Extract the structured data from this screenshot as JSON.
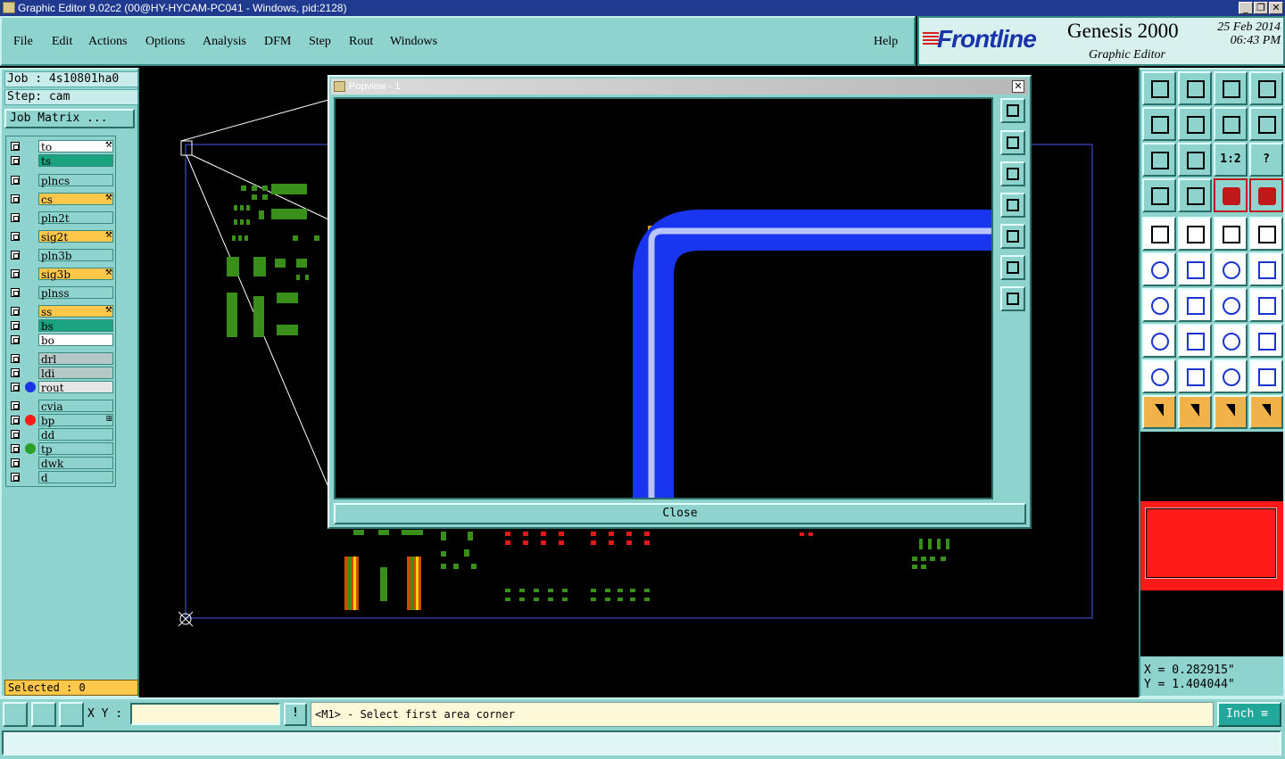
{
  "window": {
    "title": "Graphic Editor 9.02c2 (00@HY-HYCAM-PC041 - Windows, pid:2128)",
    "min": "_",
    "max": "❐",
    "close": "✕"
  },
  "menu": {
    "items": [
      "File",
      "Edit",
      "Actions",
      "Options",
      "Analysis",
      "DFM",
      "Step",
      "Rout",
      "Windows"
    ],
    "help": "Help"
  },
  "brand": {
    "logo": "Frontline",
    "product": "Genesis 2000",
    "subtitle": "Graphic Editor",
    "date": "25 Feb 2014",
    "time": "06:43 PM"
  },
  "job": {
    "job_label": "Job : 4s10801ha0",
    "step_label": "Step: cam",
    "matrix_button": "Job Matrix ..."
  },
  "layers": [
    {
      "name": "to",
      "bg": "#ffffff",
      "mark": "⚒"
    },
    {
      "name": "ts",
      "bg": "#1aa37e",
      "mark": ""
    },
    {
      "name": "plncs",
      "bg": "#8fd3cf",
      "mark": ""
    },
    {
      "name": "cs",
      "bg": "#ffc84a",
      "mark": "⚒"
    },
    {
      "name": "pln2t",
      "bg": "#8fd3cf",
      "mark": ""
    },
    {
      "name": "sig2t",
      "bg": "#ffc84a",
      "mark": "⚒"
    },
    {
      "name": "pln3b",
      "bg": "#8fd3cf",
      "mark": ""
    },
    {
      "name": "sig3b",
      "bg": "#ffc84a",
      "mark": "⚒"
    },
    {
      "name": "plnss",
      "bg": "#8fd3cf",
      "mark": ""
    },
    {
      "name": "ss",
      "bg": "#ffc84a",
      "mark": "⚒"
    },
    {
      "name": "bs",
      "bg": "#1aa37e",
      "mark": ""
    },
    {
      "name": "bo",
      "bg": "#ffffff",
      "mark": ""
    },
    {
      "name": "drl",
      "bg": "#b4c8c6",
      "mark": ""
    },
    {
      "name": "ldi",
      "bg": "#b4c8c6",
      "mark": ""
    },
    {
      "name": "rout",
      "bg": "#e6e6e6",
      "mark": "",
      "dot": "#1a35e6"
    },
    {
      "name": "cvia",
      "bg": "#8fd3cf",
      "mark": ""
    },
    {
      "name": "bp",
      "bg": "#8fd3cf",
      "mark": "⊞",
      "dot": "#ff1a1a"
    },
    {
      "name": "dd",
      "bg": "#8fd3cf",
      "mark": ""
    },
    {
      "name": "tp",
      "bg": "#8fd3cf",
      "mark": "",
      "dot": "#2aa02a"
    },
    {
      "name": "dwk",
      "bg": "#8fd3cf",
      "mark": ""
    },
    {
      "name": "d",
      "bg": "#8fd3cf",
      "mark": ""
    }
  ],
  "selected_label": "Selected : 0",
  "popview": {
    "title": "Popview - 1",
    "close_x": "✕",
    "close_button": "Close"
  },
  "coords": {
    "x": "X = 0.282915\"",
    "y": "Y = 1.404044\""
  },
  "bottom": {
    "xy_label": "X Y :",
    "xy_value": "",
    "bang": "!",
    "prompt": "<M1> - Select first area corner",
    "unit": "Inch ≡"
  },
  "tools": {
    "one_to_two": "1:2",
    "help": "?"
  }
}
